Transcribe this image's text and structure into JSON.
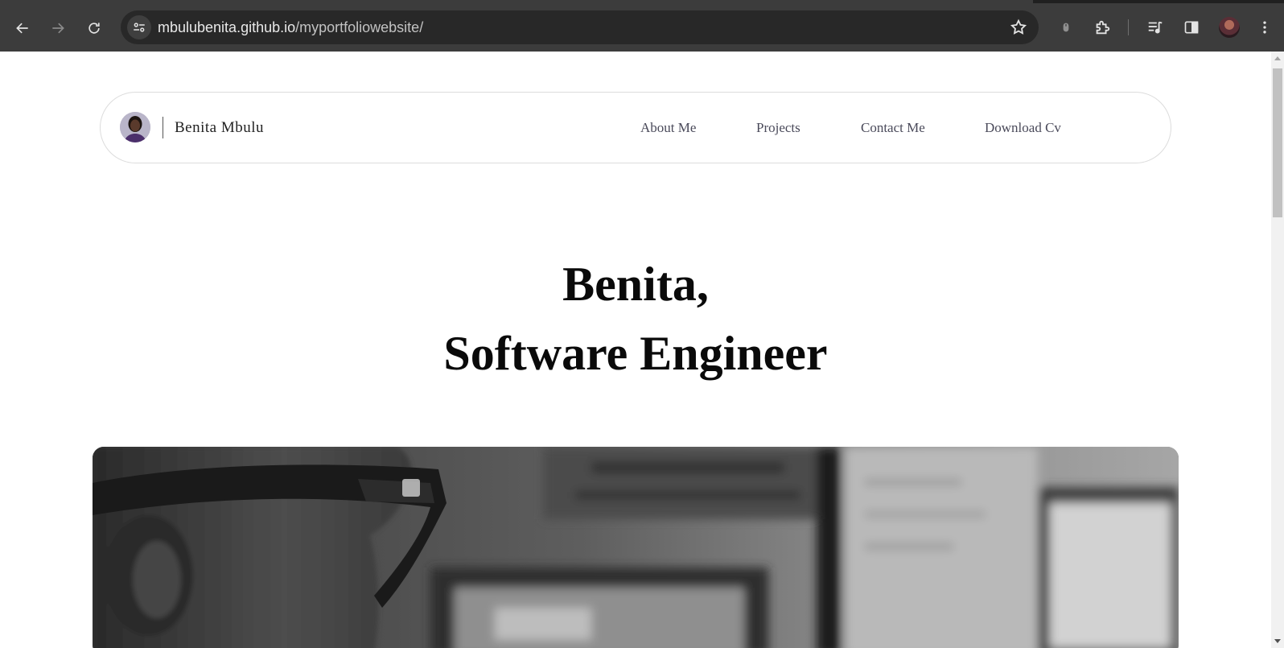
{
  "browser": {
    "url_host": "mbulubenita.github.io",
    "url_path": "/myportfoliowebsite/"
  },
  "nav": {
    "brand_name": "Benita Mbulu",
    "links": [
      {
        "label": "About Me"
      },
      {
        "label": "Projects"
      },
      {
        "label": "Contact Me"
      },
      {
        "label": "Download Cv"
      }
    ]
  },
  "hero": {
    "line1": "Benita,",
    "line2": "Software Engineer"
  },
  "colors": {
    "chrome_bg": "#3c3c3c",
    "omnibox_bg": "#282828",
    "page_bg": "#ffffff",
    "text": "#0a0a0a"
  }
}
